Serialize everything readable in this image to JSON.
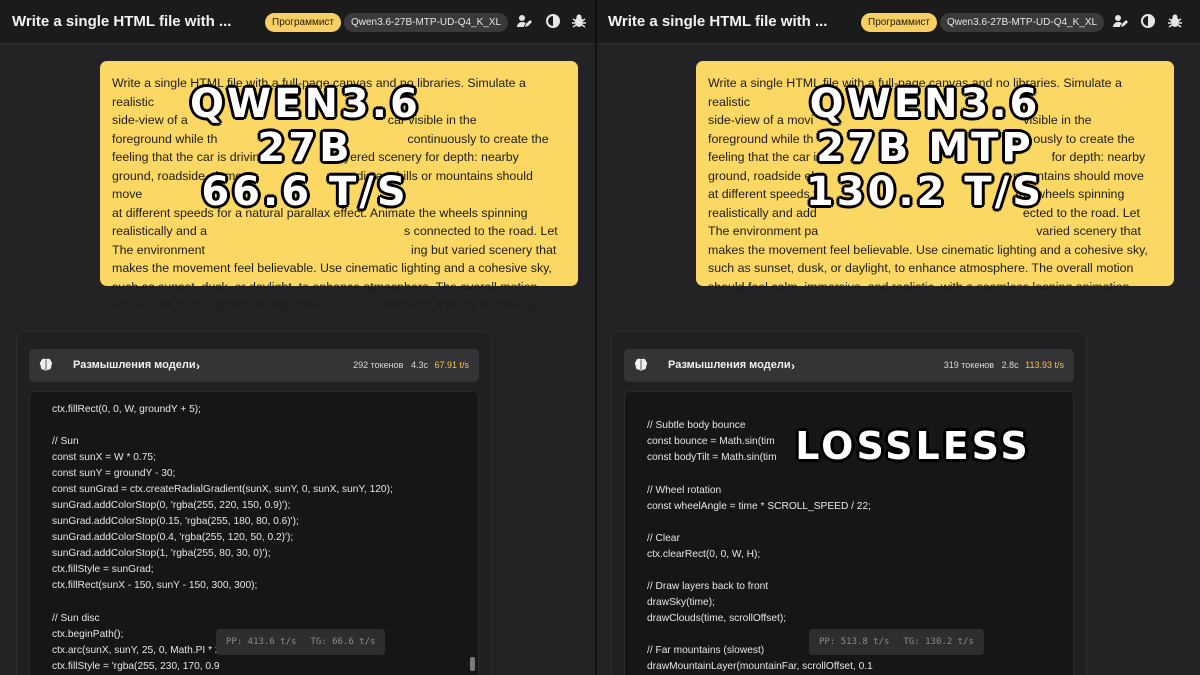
{
  "left": {
    "title": "Write a single HTML file with ...",
    "role_badge": "Программист",
    "model_badge": "Qwen3.6-27B-MTP-UD-Q4_K_XL",
    "prompt_lines": [
      "Write a single HTML file with a full-page canvas and no libraries. Simulate a realistic",
      "side-view of a",
      "foreground while th",
      "feeling that the car is driving",
      "ground, roadside element",
      "at different speeds for a natural parallax effect. Animate the wheels spinning",
      "realistically and a",
      "The environment",
      "makes the movement feel believable. Use cinematic lighting and a cohesive sky,",
      "such as sunset, dusk, or daylight, to enhance atmosphere. The overall motion",
      "should feel calm, immersive, and realistic, with a seamless looping animation."
    ],
    "prompt_fragments": {
      "l2": "car visible in the",
      "l3": "continuously to create the",
      "l4": "layered scenery for depth: nearby",
      "l5": "distant hills or mountains should move",
      "l7": "s connected to the road. Let",
      "l8": "ing but varied scenery that"
    },
    "overlay": [
      "QWEN3.6",
      "27B",
      "66.6 T/S"
    ],
    "thinking": {
      "label": "Размышления модели",
      "tokens": "292 токенов",
      "time": "4.3с",
      "speed": "67.91 t/s"
    },
    "code": [
      "ctx.fillRect(0, 0, W, groundY + 5);",
      "",
      "// Sun",
      "const sunX = W * 0.75;",
      "const sunY = groundY - 30;",
      "const sunGrad = ctx.createRadialGradient(sunX, sunY, 0, sunX, sunY, 120);",
      "sunGrad.addColorStop(0, 'rgba(255, 220, 150, 0.9)');",
      "sunGrad.addColorStop(0.15, 'rgba(255, 180, 80, 0.6)');",
      "sunGrad.addColorStop(0.4, 'rgba(255, 120, 50, 0.2)');",
      "sunGrad.addColorStop(1, 'rgba(255, 80, 30, 0)');",
      "ctx.fillStyle = sunGrad;",
      "ctx.fillRect(sunX - 150, sunY - 150, 300, 300);",
      "",
      "// Sun disc",
      "ctx.beginPath();",
      "ctx.arc(sunX, sunY, 25, 0, Math.PI * 2);",
      "ctx.fillStyle = 'rgba(255, 230, 170, 0.9"
    ],
    "pp": "PP: 413.6 t/s",
    "tg": "TG: 66.6 t/s"
  },
  "right": {
    "title": "Write a single HTML file with ...",
    "role_badge": "Программист",
    "model_badge": "Qwen3.6-27B-MTP-UD-Q4_K_XL",
    "prompt_lines": [
      "Write a single HTML file with a full-page canvas and no libraries. Simulate a realistic",
      "side-view of a movi",
      "foreground while th",
      "feeling that the car is dri",
      "ground, roadside ele",
      "at different speeds fo",
      "realistically and add",
      "The environment pa",
      "makes the movement feel believable. Use cinematic lighting and a cohesive sky,",
      "such as sunset, dusk, or daylight, to enhance atmosphere. The overall motion",
      "should feel calm, immersive, and realistic, with a seamless looping animation."
    ],
    "prompt_fragments": {
      "l2": "visible in the",
      "l3": "ously to create the",
      "l4": "for depth: nearby",
      "l5": "mountains should move",
      "l6": "the wheels spinning",
      "l7": "ected to the road. Let",
      "l8": "varied scenery that"
    },
    "overlay": [
      "QWEN3.6",
      "27B MTP",
      "130.2 T/S"
    ],
    "overlay2": "LOSSLESS",
    "thinking": {
      "label": "Размышления модели",
      "tokens": "319 токенов",
      "time": "2.8с",
      "speed": "113.93 t/s"
    },
    "code": [
      "// Subtle body bounce",
      "const bounce = Math.sin(tim",
      "const bodyTilt = Math.sin(tim",
      "",
      "// Wheel rotation",
      "const wheelAngle = time * SCROLL_SPEED / 22;",
      "",
      "// Clear",
      "ctx.clearRect(0, 0, W, H);",
      "",
      "// Draw layers back to front",
      "drawSky(time);",
      "drawClouds(time, scrollOffset);",
      "",
      "// Far mountains (slowest)",
      "drawMountainLayer(mountainFar, scrollOffset, 0.1"
    ],
    "pp": "PP: 513.8 t/s",
    "tg": "TG: 130.2 t/s"
  },
  "icons": [
    "user-edit-icon",
    "contrast-icon",
    "bug-icon",
    "brain-icon",
    "chevron-right-icon"
  ]
}
